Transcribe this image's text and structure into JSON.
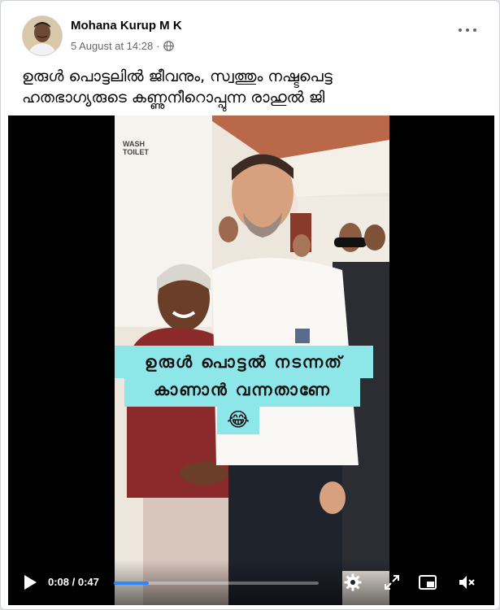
{
  "post": {
    "author": "Mohana Kurup M K",
    "date": "5 August at 14:28",
    "separator": "·",
    "privacy_icon": "globe-icon",
    "more_icon": "more-options-icon",
    "caption": "ഉരുൾ പൊട്ടലിൽ ജീവനും, സ്വത്തും നഷ്ടപെട്ട\nഹതഭാഗ്യരുടെ കണ്ണുനീറൊപ്പുന്ന രാഹുൽ ജി"
  },
  "video": {
    "sign_text": "WASH\nTOILET",
    "overlay_line1": "ഉരുൾ പൊട്ടൽ നടന്നത്",
    "overlay_line2": "കാണാൻ വന്നതാണേ",
    "overlay_emoji": "😂",
    "controls": {
      "current_time": "0:08",
      "separator": " / ",
      "duration": "0:47",
      "progress": 0.17,
      "icons": [
        "play-icon",
        "settings-icon",
        "fullscreen-icon",
        "picture-in-picture-icon",
        "volume-muted-icon"
      ]
    }
  },
  "colors": {
    "progress_fill": "#2d88ff",
    "overlay_bg": "#8de7e9",
    "author_text": "#050505",
    "meta_text": "#65676b"
  }
}
